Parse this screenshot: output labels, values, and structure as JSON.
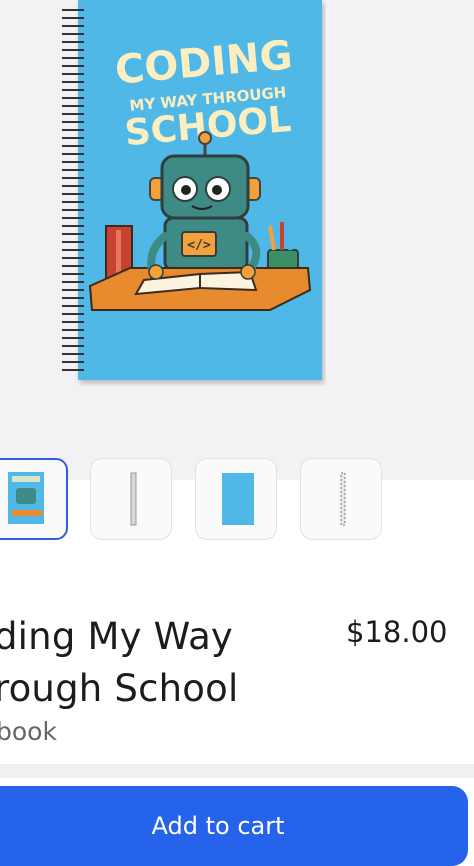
{
  "product": {
    "cover_title_line1": "CODING",
    "cover_title_line2": "MY WAY THROUGH",
    "cover_title_line3": "SCHOOL",
    "cover_code_tag": "</>",
    "title_line1": "ding My Way",
    "title_line2": "rough School",
    "subtitle": "book",
    "price": "$18.00"
  },
  "thumbnails": [
    {
      "name": "front-cover",
      "selected": true
    },
    {
      "name": "side-view",
      "selected": false
    },
    {
      "name": "blue-cover",
      "selected": false
    },
    {
      "name": "spiral-view",
      "selected": false
    }
  ],
  "actions": {
    "add_to_cart": "Add to cart"
  },
  "colors": {
    "accent": "#2563eb",
    "cover_blue": "#4fb8e6",
    "cover_text": "#fbeec0"
  }
}
